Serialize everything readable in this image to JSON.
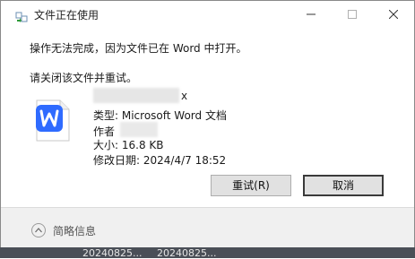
{
  "window": {
    "title": "文件正在使用",
    "icon": "file-in-use-icon",
    "controls": [
      "minimize-icon",
      "maximize-icon",
      "close-icon"
    ]
  },
  "message": {
    "line1": "操作无法完成，因为文件已在 Word 中打开。",
    "line2": "请关闭该文件并重试。"
  },
  "file": {
    "name_visible_suffix": "x",
    "type": "类型: Microsoft Word 文档",
    "author_label": "作者",
    "size": "大小: 16.8 KB",
    "modified": "修改日期: 2024/4/7 18:52",
    "icon": "wps-word-file-icon",
    "icon_color": "#2f6bff"
  },
  "buttons": {
    "retry": "重试(R)",
    "cancel": "取消"
  },
  "footer": {
    "details_label": "简略信息"
  },
  "background": {
    "labels": [
      "20240825...",
      "20240825..."
    ]
  }
}
